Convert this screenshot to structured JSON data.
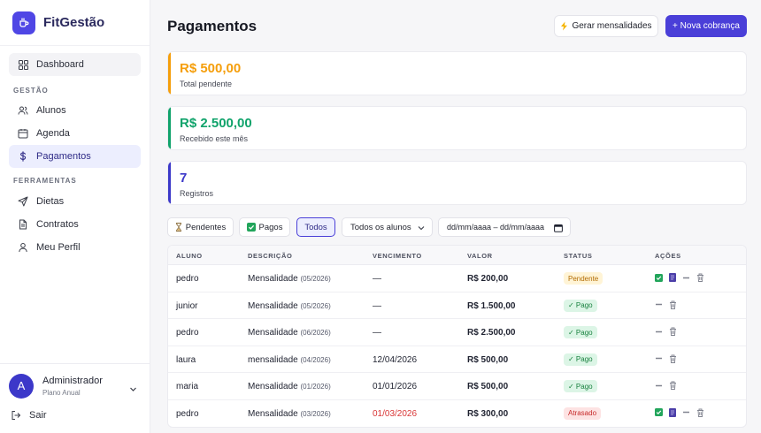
{
  "app": {
    "name": "FitGestão"
  },
  "sidebar": {
    "dashboard": "Dashboard",
    "section_gestao": "GESTÃO",
    "gestao_items": [
      {
        "label": "Alunos",
        "icon": "users-icon"
      },
      {
        "label": "Agenda",
        "icon": "calendar-icon"
      },
      {
        "label": "Pagamentos",
        "icon": "dollar-icon"
      }
    ],
    "section_ferramentas": "FERRAMENTAS",
    "ferramentas_items": [
      {
        "label": "Dietas",
        "icon": "send-icon"
      },
      {
        "label": "Contratos",
        "icon": "document-icon"
      },
      {
        "label": "Meu Perfil",
        "icon": "user-icon"
      }
    ],
    "user": {
      "initial": "A",
      "name": "Administrador",
      "plan": "Plano Anual"
    },
    "logout": "Sair"
  },
  "header": {
    "title": "Pagamentos",
    "generate_label": "Gerar mensalidades",
    "new_label": "+ Nova cobrança"
  },
  "summary": {
    "pending": {
      "amount": "R$ 500,00",
      "label": "Total pendente",
      "color": "#f59e0b"
    },
    "received": {
      "amount": "R$ 2.500,00",
      "label": "Recebido este mês",
      "color": "#10a36b"
    },
    "records": {
      "amount": "7",
      "label": "Registros",
      "color": "#3c38c9"
    }
  },
  "filters": {
    "pending": "Pendentes",
    "paid": "Pagos",
    "all": "Todos",
    "student_select": "Todos os alunos",
    "date_range": "dd/mm/aaaa – dd/mm/aaaa"
  },
  "table": {
    "headers": [
      "ALUNO",
      "DESCRIÇÃO",
      "VENCIMENTO",
      "VALOR",
      "STATUS",
      "AÇÕES"
    ],
    "rows": [
      {
        "aluno": "pedro",
        "desc": "Mensalidade",
        "periodo": "(05/2026)",
        "venc": "—",
        "valor": "R$ 200,00",
        "status": "Pendente"
      },
      {
        "aluno": "junior",
        "desc": "Mensalidade",
        "periodo": "(05/2026)",
        "venc": "—",
        "valor": "R$ 1.500,00",
        "status": "✓ Pago"
      },
      {
        "aluno": "pedro",
        "desc": "Mensalidade",
        "periodo": "(06/2026)",
        "venc": "—",
        "valor": "R$ 2.500,00",
        "status": "✓ Pago"
      },
      {
        "aluno": "laura",
        "desc": "mensalidade",
        "periodo": "(04/2026)",
        "venc": "12/04/2026",
        "valor": "R$ 500,00",
        "status": "✓ Pago"
      },
      {
        "aluno": "maria",
        "desc": "Mensalidade",
        "periodo": "(01/2026)",
        "venc": "01/01/2026",
        "valor": "R$ 500,00",
        "status": "✓ Pago"
      },
      {
        "aluno": "pedro",
        "desc": "Mensalidade",
        "periodo": "(03/2026)",
        "venc": "01/03/2026",
        "valor": "R$ 300,00",
        "status": "Atrasado"
      }
    ]
  }
}
